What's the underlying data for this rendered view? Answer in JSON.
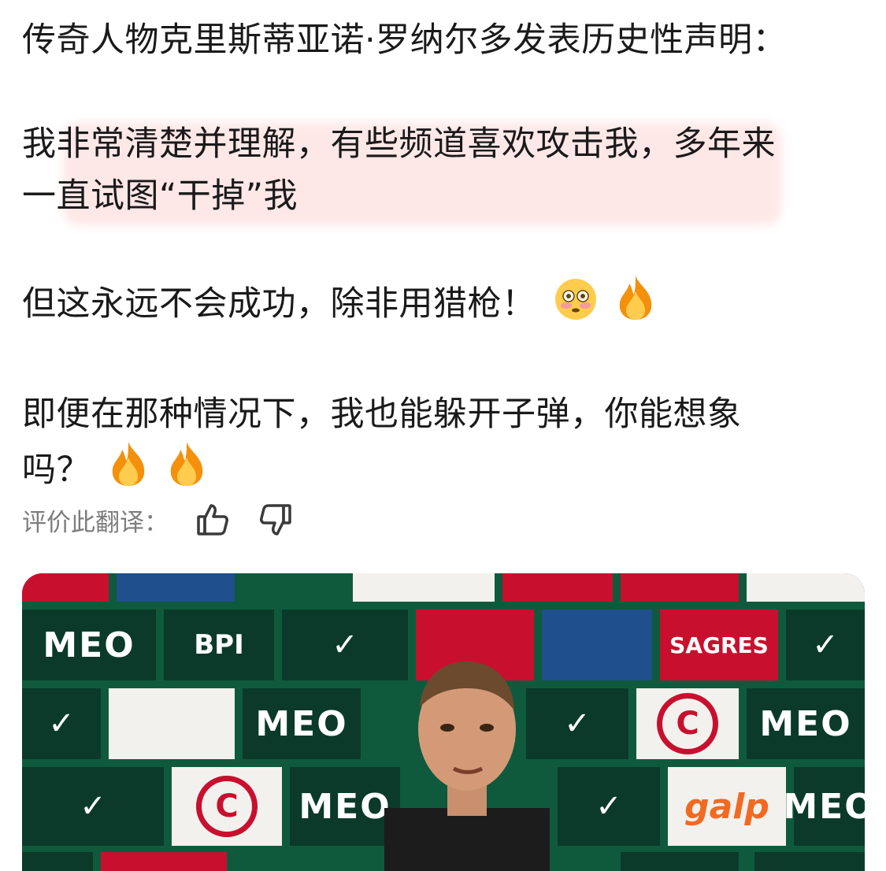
{
  "post": {
    "title": "传奇人物克里斯蒂亚诺·罗纳尔多发表历史性声明：",
    "para1_line1": "我非常清楚并理解，有些频道喜欢攻击我，多年来",
    "para1_line2": "一直试图“干掉”我",
    "para2": "但这永远不会成功，除非用猎枪！",
    "para3_line1": "即便在那种情况下，我也能躲开子弹，你能想象",
    "para3_line2": "吗？",
    "emoji_flushed": "flushed-face-emoji",
    "emoji_fire": "fire-emoji"
  },
  "translation_rating": {
    "label": "评价此翻译：",
    "up_icon": "thumbs-up-icon",
    "down_icon": "thumbs-down-icon"
  },
  "media": {
    "sponsors": [
      "MEO",
      "BPI",
      "galp",
      "SAGRES"
    ]
  },
  "colors": {
    "text": "#1a1a1a",
    "secondary": "#7d7d7d",
    "board_green": "#0d6b45",
    "brand_red": "#c8102e"
  }
}
